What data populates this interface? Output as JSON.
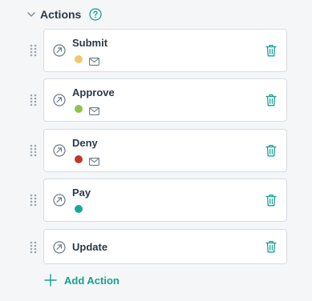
{
  "section": {
    "title": "Actions",
    "help_icon": "help-circle-icon",
    "collapse_icon": "chevron-down-icon"
  },
  "colors": {
    "accent": "#17a08f",
    "border": "#d7dde3",
    "icon_gray": "#6b7a86"
  },
  "actions": [
    {
      "name": "Submit",
      "status_color": "#f2c76e",
      "has_email": true
    },
    {
      "name": "Approve",
      "status_color": "#8cc44c",
      "has_email": true
    },
    {
      "name": "Deny",
      "status_color": "#c0392b",
      "has_email": true
    },
    {
      "name": "Pay",
      "status_color": "#18a89a",
      "has_email": false
    },
    {
      "name": "Update",
      "status_color": null,
      "has_email": false
    }
  ],
  "add_action": {
    "label": "Add Action",
    "icon": "plus-icon"
  }
}
